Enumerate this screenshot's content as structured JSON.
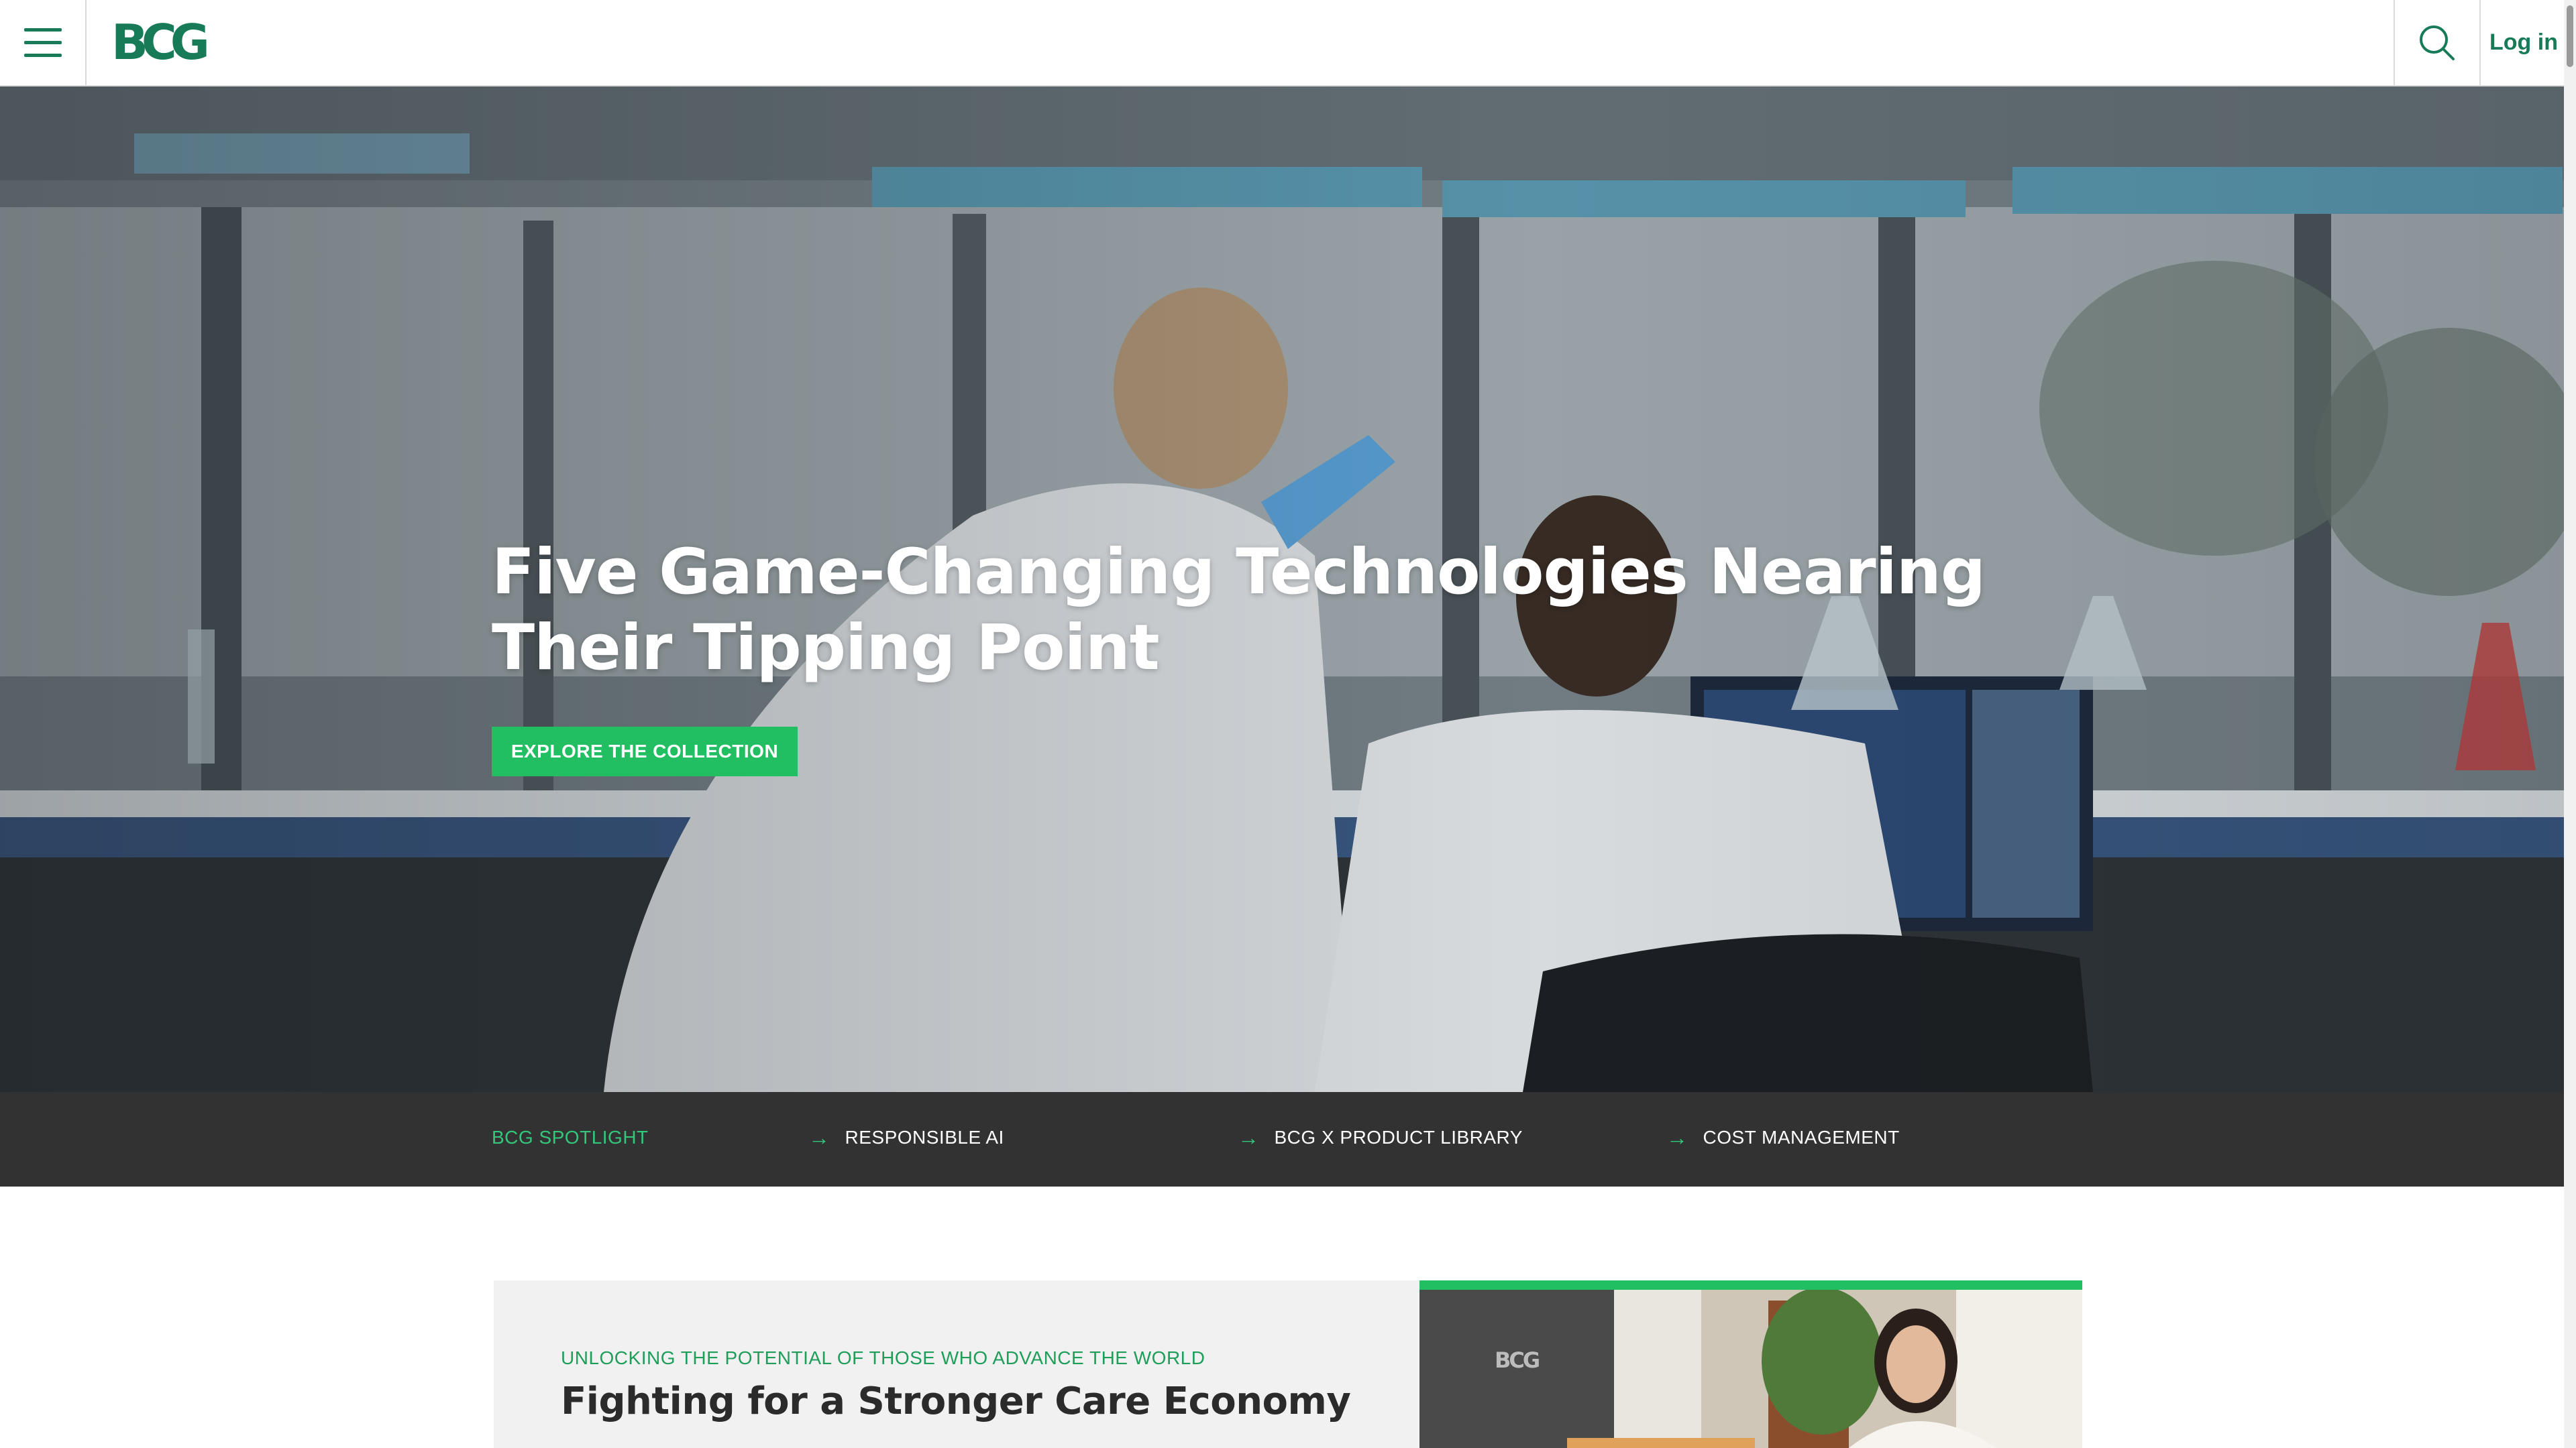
{
  "header": {
    "logo_text": "BCG",
    "login_label": "Log in",
    "colors": {
      "brand_green": "#177b57",
      "cta_green": "#21bf61"
    }
  },
  "hero": {
    "title": "Five Game-Changing Technologies Nearing Their Tipping Point",
    "cta_label": "EXPLORE THE COLLECTION"
  },
  "spotlight": {
    "label": "BCG SPOTLIGHT",
    "links": [
      {
        "label": "RESPONSIBLE AI",
        "icon": "arrow-right-icon"
      },
      {
        "label": "BCG X PRODUCT LIBRARY",
        "icon": "arrow-right-icon"
      },
      {
        "label": "COST MANAGEMENT",
        "icon": "arrow-right-icon"
      }
    ]
  },
  "feature_card": {
    "eyebrow": "UNLOCKING THE POTENTIAL OF THOSE WHO ADVANCE THE WORLD",
    "title": "Fighting for a Stronger Care Economy",
    "image_sign_text": "BCG"
  },
  "icons": {
    "menu": "hamburger-menu-icon",
    "search": "search-icon"
  }
}
